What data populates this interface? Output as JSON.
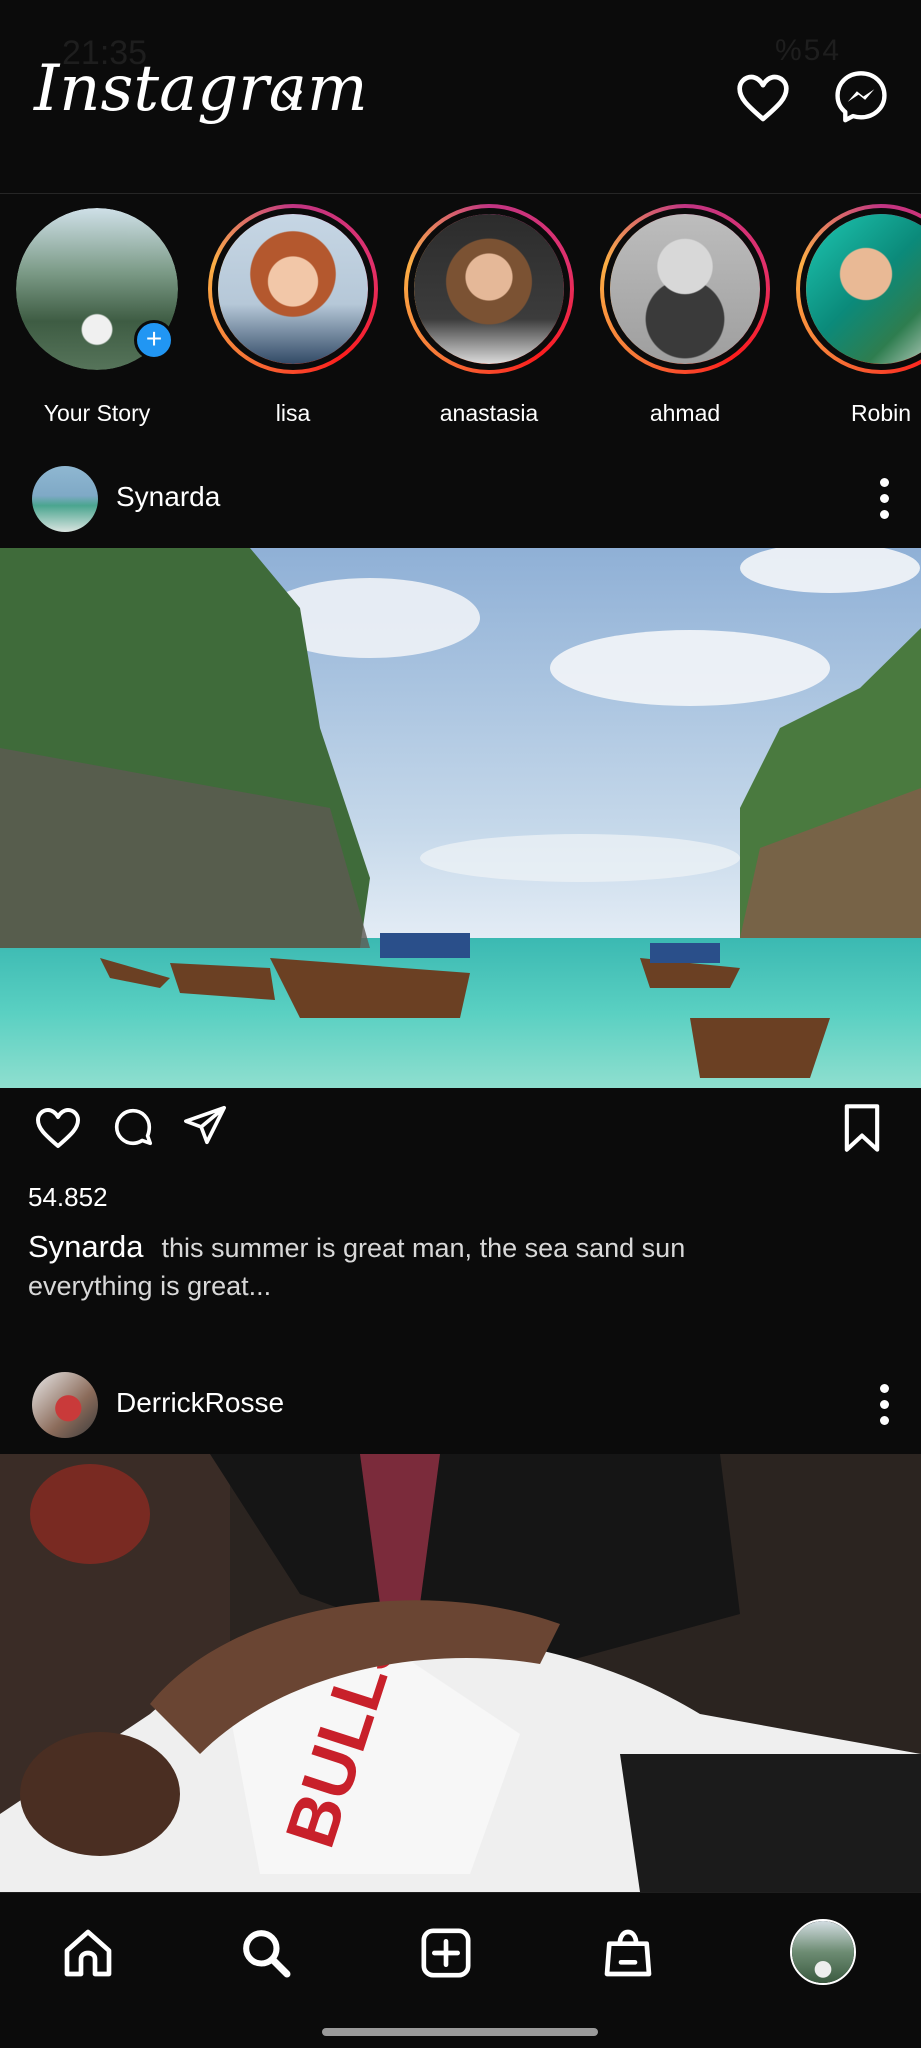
{
  "status_bar": {
    "time": "21:35",
    "battery": "%54"
  },
  "header": {
    "logo": "Instagram"
  },
  "stories": [
    {
      "name": "Your Story",
      "own": true
    },
    {
      "name": "lisa"
    },
    {
      "name": "anastasia"
    },
    {
      "name": "ahmad"
    },
    {
      "name": "Robin"
    }
  ],
  "posts": [
    {
      "username": "Synarda",
      "likes": "54.852",
      "caption_user": "Synarda",
      "caption_text": "this summer is great man, the sea sand sun everything is great..."
    },
    {
      "username": "DerrickRosse"
    }
  ],
  "icons": {
    "header": [
      "chevron-down-icon",
      "heart-icon",
      "messenger-icon"
    ],
    "post_actions": [
      "heart-icon",
      "comment-icon",
      "share-icon",
      "bookmark-icon"
    ],
    "nav": [
      "home-icon",
      "search-icon",
      "add-post-icon",
      "shop-icon",
      "profile-avatar"
    ]
  },
  "colors": {
    "background": "#0b0b0b",
    "story_ring": "#e1306c",
    "add_badge": "#2196f3"
  }
}
